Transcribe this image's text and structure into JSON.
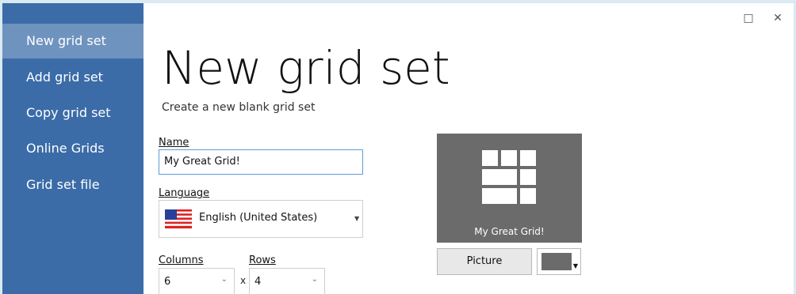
{
  "sidebar": {
    "items": [
      {
        "label": "New grid set",
        "active": true
      },
      {
        "label": "Add grid set",
        "active": false
      },
      {
        "label": "Copy grid set",
        "active": false
      },
      {
        "label": "Online Grids",
        "active": false
      },
      {
        "label": "Grid set file",
        "active": false
      }
    ]
  },
  "window_controls": {
    "maximize": "□",
    "close": "✕"
  },
  "main": {
    "title": "New grid set",
    "subtitle": "Create a new blank grid set"
  },
  "form": {
    "name": {
      "label_first": "N",
      "label_rest": "ame",
      "value": "My Great Grid!"
    },
    "language": {
      "label_first": "L",
      "label_rest": "anguage",
      "value": "English (United States)",
      "flag_icon": "us-flag-icon"
    },
    "columns": {
      "label_first": "C",
      "label_rest": "olumns",
      "value": "6"
    },
    "rows": {
      "label_first": "R",
      "label_rest": "ows",
      "value": "4"
    },
    "times_symbol": "x"
  },
  "preview": {
    "caption": "My Great Grid!",
    "icon": "grid-icon",
    "tile_color": "#6b6b6b",
    "picture_button": "Picture",
    "swatch_color": "#6b6b6b"
  },
  "colors": {
    "sidebar_bg": "#3b6ca8",
    "sidebar_active": "#6f93bf",
    "input_focus_border": "#5f9bd8"
  }
}
